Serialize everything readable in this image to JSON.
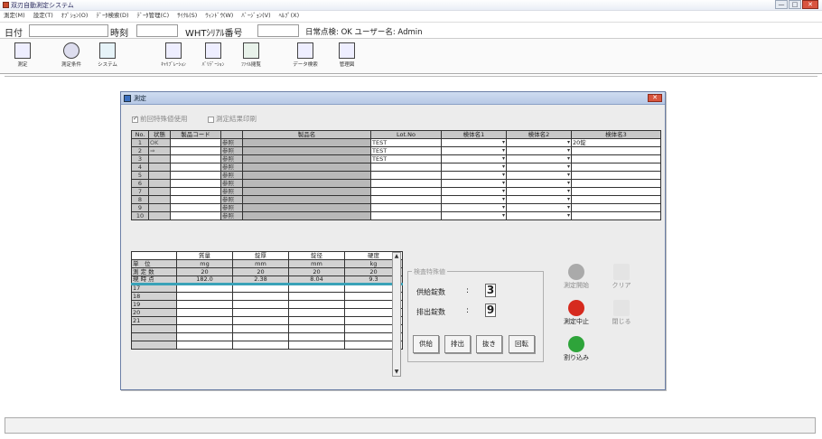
{
  "window": {
    "title": "双刃自動測定システム",
    "min": "—",
    "max": "□",
    "close": "✕"
  },
  "menu": [
    "測定(M)",
    "設定(T)",
    "ｵﾌﾟｼｮﾝ(O)",
    "ﾃﾞｰﾀ検索(D)",
    "ﾃﾞｰﾀ管理(C)",
    "ｻｲｸﾙ(S)",
    "ｳｨﾝﾄﾞｳ(W)",
    "ﾊﾞｰｼﾞｮﾝ(V)",
    "ﾍﾙﾌﾟ(X)"
  ],
  "info": {
    "date_label": "日付",
    "date_value": "",
    "time_label": "時刻",
    "time_value": "",
    "serial_label": "WHTｼﾘｱﾙ番号",
    "serial_value": "",
    "status_text": "日常点検: OK  ユーザー名: Admin"
  },
  "toolbar": [
    "測定",
    "測定条件",
    "システム",
    "ｷｬﾘﾌﾞﾚｰｼｮﾝ",
    "ﾊﾞﾘﾃﾞｰｼｮﾝ",
    "ﾌｧｲﾙ閲覧",
    "データ検索",
    "管理図"
  ],
  "dialog": {
    "title": "測定",
    "close": "✕",
    "opt1": "前回特殊値使用",
    "opt2": "測定結果印刷",
    "columns": [
      "No.",
      "状態",
      "製品コード",
      "",
      "製品名",
      "Lot.No",
      "検体名1",
      "検体名2",
      "検体名3"
    ],
    "rows": [
      {
        "no": "1",
        "state": "OK",
        "code": "",
        "ref": "参照",
        "name": "",
        "lot": "TEST",
        "s1": "",
        "s2": "",
        "s3": "20錠"
      },
      {
        "no": "2",
        "state": "⇒",
        "code": "",
        "ref": "参照",
        "name": "",
        "lot": "TEST",
        "s1": "",
        "s2": "",
        "s3": ""
      },
      {
        "no": "3",
        "state": "",
        "code": "",
        "ref": "参照",
        "name": "",
        "lot": "TEST",
        "s1": "",
        "s2": "",
        "s3": ""
      },
      {
        "no": "4",
        "state": "",
        "code": "",
        "ref": "参照",
        "name": "",
        "lot": "",
        "s1": "",
        "s2": "",
        "s3": ""
      },
      {
        "no": "5",
        "state": "",
        "code": "",
        "ref": "参照",
        "name": "",
        "lot": "",
        "s1": "",
        "s2": "",
        "s3": ""
      },
      {
        "no": "6",
        "state": "",
        "code": "",
        "ref": "参照",
        "name": "",
        "lot": "",
        "s1": "",
        "s2": "",
        "s3": ""
      },
      {
        "no": "7",
        "state": "",
        "code": "",
        "ref": "参照",
        "name": "",
        "lot": "",
        "s1": "",
        "s2": "",
        "s3": ""
      },
      {
        "no": "8",
        "state": "",
        "code": "",
        "ref": "参照",
        "name": "",
        "lot": "",
        "s1": "",
        "s2": "",
        "s3": ""
      },
      {
        "no": "9",
        "state": "",
        "code": "",
        "ref": "参照",
        "name": "",
        "lot": "",
        "s1": "",
        "s2": "",
        "s3": ""
      },
      {
        "no": "10",
        "state": "",
        "code": "",
        "ref": "参照",
        "name": "",
        "lot": "",
        "s1": "",
        "s2": "",
        "s3": ""
      }
    ],
    "result_cols": [
      "",
      "質量",
      "錠厚",
      "錠径",
      "硬度"
    ],
    "result_head_rows": [
      [
        "単　位",
        "mg",
        "mm",
        "mm",
        "kg"
      ],
      [
        "測 定 数",
        "20",
        "20",
        "20",
        "20"
      ],
      [
        "現 時 点",
        "182.0",
        "2.38",
        "8.04",
        "9.3"
      ]
    ],
    "result_rows": [
      "17",
      "18",
      "19",
      "20",
      "21",
      "",
      "",
      ""
    ],
    "group": {
      "title": "検査特殊値",
      "r1": "供給錠数",
      "r1_val": "3",
      "r2": "排出錠数",
      "r2_val": "9",
      "colon": ":",
      "btns": [
        "供給",
        "排出",
        "抜き",
        "回転"
      ]
    },
    "actions": {
      "start": "測定開始",
      "clear": "クリア",
      "stop": "測定中止",
      "close": "閉じる",
      "interrupt": "割り込み"
    }
  }
}
